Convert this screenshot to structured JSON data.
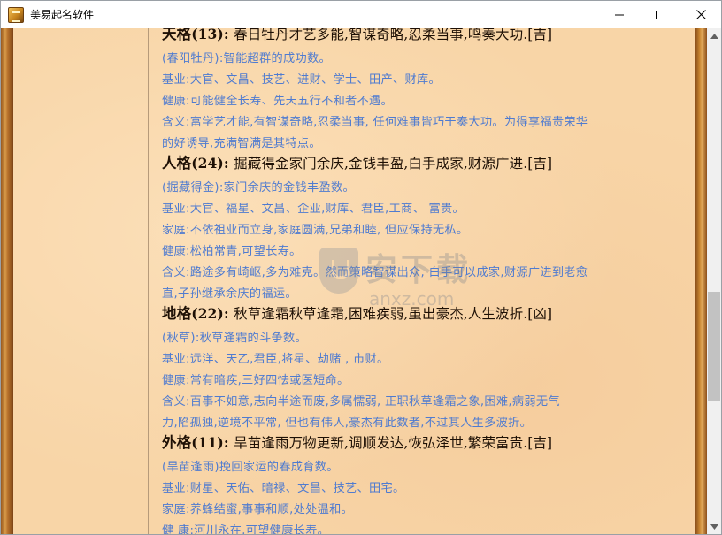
{
  "window": {
    "title": "美易起名软件"
  },
  "watermark": {
    "cn": "安下载",
    "en": "anxz.com"
  },
  "content": {
    "lines": [
      {
        "type": "head",
        "name": "天格",
        "num": "(13)",
        "text": "春日牡丹才艺多能,智谋奇略,忍柔当事,鸣奏大功.[吉]"
      },
      {
        "type": "text",
        "text": "(春阳牡丹):智能超群的成功数。"
      },
      {
        "type": "text",
        "text": " 基业:大官、文昌、技艺、进财、学士、田产、财库。"
      },
      {
        "type": "text",
        "text": " 健康:可能健全长寿、先天五行不和者不遇。"
      },
      {
        "type": "text",
        "text": " 含义:富学艺才能,有智谋奇略,忍柔当事, 任何难事皆巧于奏大功。为得享福贵荣华"
      },
      {
        "type": "text",
        "text": "的好诱导,充满智满是其特点。"
      },
      {
        "type": "head",
        "name": "人格",
        "num": "(24)",
        "text": "掘藏得金家门余庆,金钱丰盈,白手成家,财源广进.[吉]"
      },
      {
        "type": "text",
        "text": "(掘藏得金):家门余庆的金钱丰盈数。"
      },
      {
        "type": "text",
        "text": " 基业:大官、福星、文昌、企业,财库、君臣,工商、 富贵。"
      },
      {
        "type": "text",
        "text": " 家庭:不依祖业而立身,家庭圆满,兄弟和睦, 但应保持无私。"
      },
      {
        "type": "text",
        "text": " 健康:松柏常青,可望长寿。"
      },
      {
        "type": "text",
        "text": " 含义:路途多有崎岖,多为难克。然而策略智谋出众, 白手可以成家,财源广进到老愈"
      },
      {
        "type": "text",
        "text": "直,子孙继承余庆的福运。"
      },
      {
        "type": "head",
        "name": "地格",
        "num": "(22)",
        "text": "秋草逢霜秋草逢霜,困难疾弱,虽出豪杰,人生波折.[凶]"
      },
      {
        "type": "text",
        "text": "(秋草):秋草逢霜的斗争数。"
      },
      {
        "type": "text",
        "text": " 基业:远洋、天乙,君臣,将星、劫赌 , 市财。"
      },
      {
        "type": "text",
        "text": " 健康:常有暗疾,三好四怯或医短命。"
      },
      {
        "type": "text",
        "text": " 含义:百事不如意,志向半途而废,多属懦弱, 正职秋草逢霜之象,困难,病弱无气"
      },
      {
        "type": "text",
        "text": "力,陷孤独,逆境不平常, 但也有伟人,豪杰有此数者,不过其人生多波折。"
      },
      {
        "type": "head",
        "name": "外格",
        "num": "(11)",
        "text": "旱苗逢雨万物更新,调顺发达,恢弘泽世,繁荣富贵.[吉]"
      },
      {
        "type": "text",
        "text": "(旱苗逢雨)挽回家运的春成育数。"
      },
      {
        "type": "text",
        "text": " 基业:财星、天佑、暗禄、文昌、技艺、田宅。"
      },
      {
        "type": "text",
        "text": " 家庭:养蜂结蜜,事事和顺,处处温和。"
      },
      {
        "type": "text",
        "text": " 健 康:河川永在,可望健康长寿。"
      }
    ]
  }
}
